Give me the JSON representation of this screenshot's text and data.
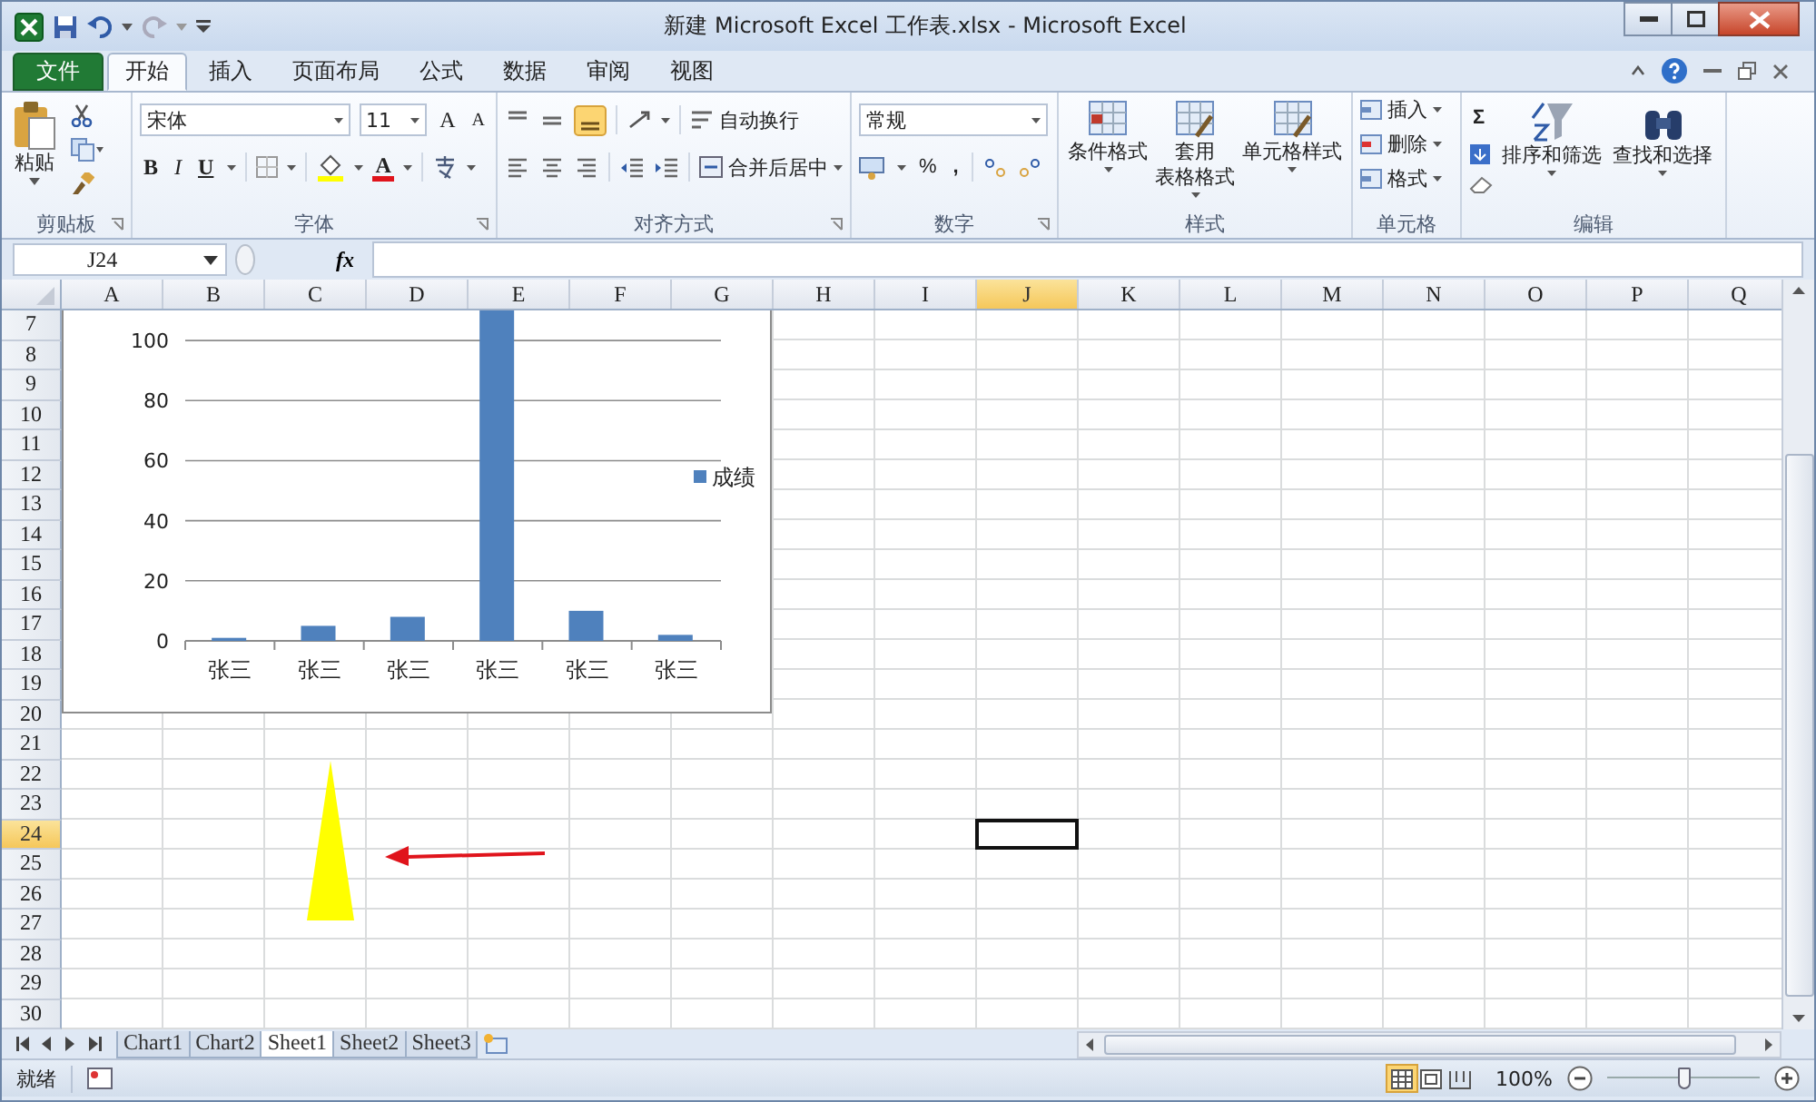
{
  "window": {
    "title": "新建 Microsoft Excel 工作表.xlsx - Microsoft Excel"
  },
  "ribbon_tabs": [
    {
      "label": "文件",
      "kind": "file",
      "selected": false
    },
    {
      "label": "开始",
      "kind": "tab",
      "selected": true
    },
    {
      "label": "插入",
      "kind": "tab",
      "selected": false
    },
    {
      "label": "页面布局",
      "kind": "tab",
      "selected": false
    },
    {
      "label": "公式",
      "kind": "tab",
      "selected": false
    },
    {
      "label": "数据",
      "kind": "tab",
      "selected": false
    },
    {
      "label": "审阅",
      "kind": "tab",
      "selected": false
    },
    {
      "label": "视图",
      "kind": "tab",
      "selected": false
    }
  ],
  "clipboard": {
    "paste": "粘贴",
    "label": "剪贴板"
  },
  "font": {
    "name": "宋体",
    "size": "11",
    "grow": "A",
    "shrink": "A",
    "bold": "B",
    "italic": "I",
    "underline": "U",
    "color_letter": "A",
    "label": "字体"
  },
  "alignment": {
    "wrap": "自动换行",
    "merge": "合并后居中",
    "label": "对齐方式"
  },
  "number": {
    "format": "常规",
    "percent": "%",
    "comma": ",",
    "label": "数字"
  },
  "styles": {
    "buttons": [
      {
        "lines": [
          "条件格式"
        ]
      },
      {
        "lines": [
          "套用",
          "表格格式"
        ]
      },
      {
        "lines": [
          "单元格样式"
        ]
      }
    ],
    "label": "样式"
  },
  "cells": {
    "items": [
      "插入",
      "删除",
      "格式"
    ],
    "label": "单元格"
  },
  "editing": {
    "sum": "Σ",
    "buttons": [
      "排序和筛选",
      "查找和选择"
    ],
    "label": "编辑"
  },
  "formula_bar": {
    "name_box": "J24",
    "fx": "fx"
  },
  "columns": [
    {
      "label": "A",
      "selected": false
    },
    {
      "label": "B",
      "selected": false
    },
    {
      "label": "C",
      "selected": false
    },
    {
      "label": "D",
      "selected": false
    },
    {
      "label": "E",
      "selected": false
    },
    {
      "label": "F",
      "selected": false
    },
    {
      "label": "G",
      "selected": false
    },
    {
      "label": "H",
      "selected": false
    },
    {
      "label": "I",
      "selected": false
    },
    {
      "label": "J",
      "selected": true
    },
    {
      "label": "K",
      "selected": false
    },
    {
      "label": "L",
      "selected": false
    },
    {
      "label": "M",
      "selected": false
    },
    {
      "label": "N",
      "selected": false
    },
    {
      "label": "O",
      "selected": false
    },
    {
      "label": "P",
      "selected": false
    },
    {
      "label": "Q",
      "selected": false
    }
  ],
  "rows": [
    {
      "label": "7",
      "selected": false
    },
    {
      "label": "8",
      "selected": false
    },
    {
      "label": "9",
      "selected": false
    },
    {
      "label": "10",
      "selected": false
    },
    {
      "label": "11",
      "selected": false
    },
    {
      "label": "12",
      "selected": false
    },
    {
      "label": "13",
      "selected": false
    },
    {
      "label": "14",
      "selected": false
    },
    {
      "label": "15",
      "selected": false
    },
    {
      "label": "16",
      "selected": false
    },
    {
      "label": "17",
      "selected": false
    },
    {
      "label": "18",
      "selected": false
    },
    {
      "label": "19",
      "selected": false
    },
    {
      "label": "20",
      "selected": false
    },
    {
      "label": "21",
      "selected": false
    },
    {
      "label": "22",
      "selected": false
    },
    {
      "label": "23",
      "selected": false
    },
    {
      "label": "24",
      "selected": true
    },
    {
      "label": "25",
      "selected": false
    },
    {
      "label": "26",
      "selected": false
    },
    {
      "label": "27",
      "selected": false
    },
    {
      "label": "28",
      "selected": false
    },
    {
      "label": "29",
      "selected": false
    },
    {
      "label": "30",
      "selected": false
    }
  ],
  "chart": {
    "chart_data": {
      "type": "bar",
      "categories": [
        "张三",
        "张三",
        "张三",
        "张三",
        "张三",
        "张三"
      ],
      "series": [
        {
          "name": "成绩",
          "color": "#4f81bd",
          "values": [
            1,
            5,
            8,
            110,
            10,
            2
          ]
        }
      ],
      "yticks": [
        0,
        20,
        40,
        60,
        80,
        100
      ],
      "ylim": [
        0,
        110
      ],
      "grid": true
    }
  },
  "sheet_tabs": [
    {
      "label": "Chart1",
      "selected": false
    },
    {
      "label": "Chart2",
      "selected": false
    },
    {
      "label": "Sheet1",
      "selected": true
    },
    {
      "label": "Sheet2",
      "selected": false
    },
    {
      "label": "Sheet3",
      "selected": false
    }
  ],
  "status_bar": {
    "status": "就绪",
    "views": [
      {
        "kind": "normal",
        "selected": true
      },
      {
        "kind": "layout",
        "selected": false
      },
      {
        "kind": "pagebreak",
        "selected": false
      }
    ],
    "zoom": "100%",
    "zoom_slider": {
      "level": 0.5
    }
  }
}
